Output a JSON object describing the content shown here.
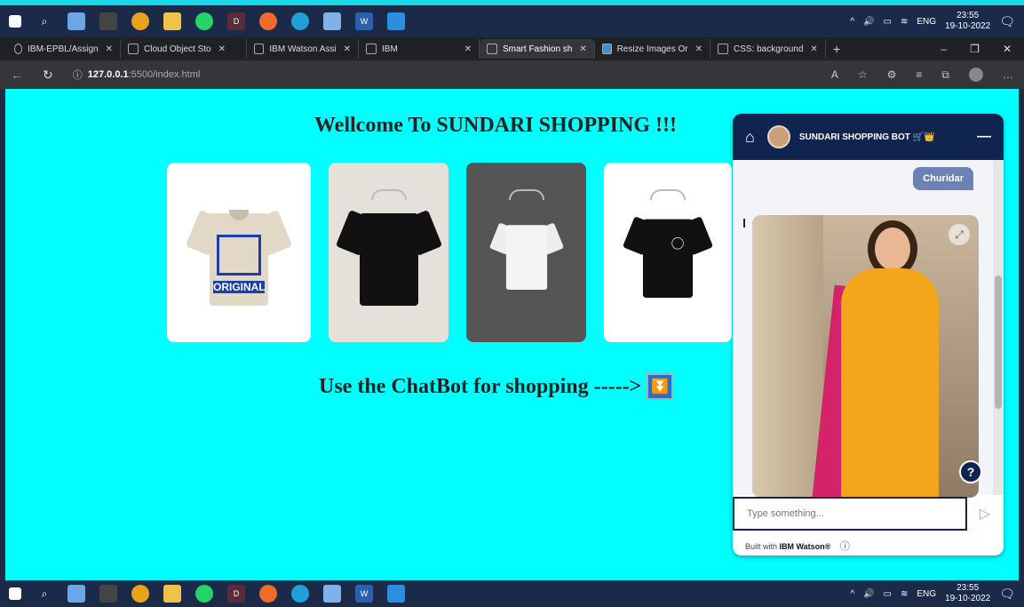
{
  "taskbar": {
    "icons": [
      "windows-icon",
      "search-icon",
      "files-icon",
      "terminal-icon",
      "chrome-icon",
      "folder-icon",
      "whatsapp-icon",
      "d-icon",
      "compass-icon",
      "edge-icon",
      "notes-icon",
      "word-icon",
      "vscode-icon"
    ],
    "lang": "ENG",
    "time": "23:55",
    "date": "19-10-2022"
  },
  "tabs": [
    {
      "label": "IBM-EPBL/Assign",
      "active": false
    },
    {
      "label": "Cloud Object Sto",
      "active": false
    },
    {
      "label": "IBM Watson Assi",
      "active": false
    },
    {
      "label": "IBM",
      "active": false
    },
    {
      "label": "Smart Fashion sh",
      "active": true
    },
    {
      "label": "Resize Images Or",
      "active": false
    },
    {
      "label": "CSS: background",
      "active": false
    }
  ],
  "address": {
    "host": "127.0.0.1",
    "path": ":5500/index.html"
  },
  "page": {
    "title": "Wellcome To SUNDARI SHOPPING !!!",
    "cta": "Use the ChatBot for shopping ----->",
    "cta_icon": "⏬",
    "shirt_label": "ORIGINAL"
  },
  "chat": {
    "bot_name": "SUNDARI SHOPPING BOT 🛒👑",
    "user_message": "Churidar",
    "input_placeholder": "Type something...",
    "built_prefix": "Built with ",
    "built_brand": "IBM Watson®",
    "help": "?"
  }
}
